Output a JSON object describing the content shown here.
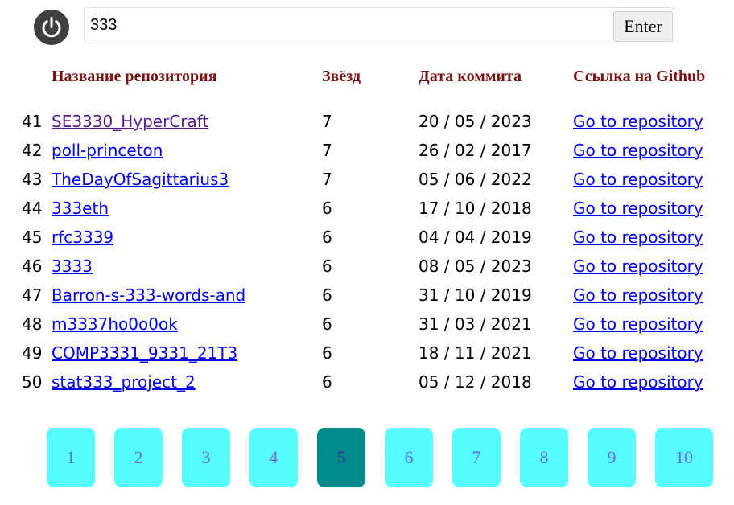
{
  "search": {
    "value": "333",
    "enter_label": "Enter"
  },
  "table": {
    "headers": {
      "name": "Название репозитория",
      "stars": "Звёзд",
      "date": "Дата коммита",
      "link": "Ссылка на Github"
    },
    "rows": [
      {
        "num": "41",
        "name": "SE3330_HyperCraft",
        "stars": "7",
        "date": "20 / 05 / 2023",
        "link": "Go to repository",
        "visited": true
      },
      {
        "num": "42",
        "name": "poll-princeton",
        "stars": "7",
        "date": "26 / 02 / 2017",
        "link": "Go to repository",
        "visited": false
      },
      {
        "num": "43",
        "name": "TheDayOfSagittarius3",
        "stars": "7",
        "date": "05 / 06 / 2022",
        "link": "Go to repository",
        "visited": false
      },
      {
        "num": "44",
        "name": "333eth",
        "stars": "6",
        "date": "17 / 10 / 2018",
        "link": "Go to repository",
        "visited": false
      },
      {
        "num": "45",
        "name": "rfc3339",
        "stars": "6",
        "date": "04 / 04 / 2019",
        "link": "Go to repository",
        "visited": false
      },
      {
        "num": "46",
        "name": "3333",
        "stars": "6",
        "date": "08 / 05 / 2023",
        "link": "Go to repository",
        "visited": false
      },
      {
        "num": "47",
        "name": "Barron-s-333-words-and-",
        "stars": "6",
        "date": "31 / 10 / 2019",
        "link": "Go to repository",
        "visited": false
      },
      {
        "num": "48",
        "name": "m3337ho0o0ok",
        "stars": "6",
        "date": "31 / 03 / 2021",
        "link": "Go to repository",
        "visited": false
      },
      {
        "num": "49",
        "name": "COMP3331_9331_21T3",
        "stars": "6",
        "date": "18 / 11 / 2021",
        "link": "Go to repository",
        "visited": false
      },
      {
        "num": "50",
        "name": "stat333_project_2",
        "stars": "6",
        "date": "05 / 12 / 2018",
        "link": "Go to repository",
        "visited": false
      }
    ]
  },
  "pagination": {
    "pages": [
      "1",
      "2",
      "3",
      "4",
      "5",
      "6",
      "7",
      "8",
      "9",
      "10"
    ],
    "active": "5"
  },
  "icons": {
    "power": "power-icon"
  }
}
